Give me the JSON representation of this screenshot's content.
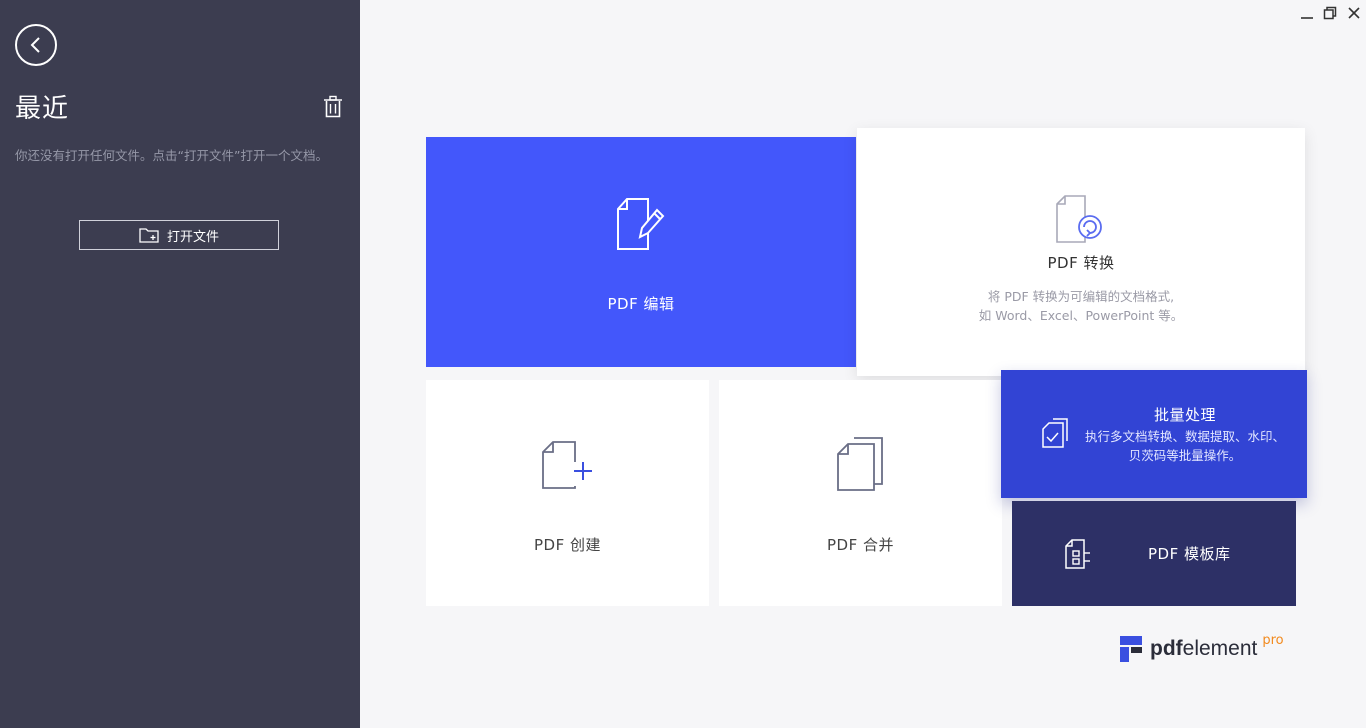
{
  "sidebar": {
    "title": "最近",
    "empty_message": "你还没有打开任何文件。点击“打开文件”打开一个文档。",
    "open_file_label": "打开文件"
  },
  "tiles": {
    "edit": {
      "label": "PDF 编辑",
      "icon": "edit-document-icon"
    },
    "convert": {
      "label": "PDF 转换",
      "desc_line1": "将 PDF 转换为可编辑的文档格式,",
      "desc_line2": "如 Word、Excel、PowerPoint 等。",
      "icon": "convert-document-icon"
    },
    "create": {
      "label": "PDF 创建",
      "icon": "create-document-icon"
    },
    "merge": {
      "label": "PDF 合并",
      "icon": "merge-documents-icon"
    },
    "batch": {
      "label": "批量处理",
      "desc_line1": "执行多文档转换、数据提取、水印、",
      "desc_line2": "贝茨码等批量操作。",
      "icon": "batch-process-icon"
    },
    "template": {
      "label": "PDF 模板库",
      "icon": "template-library-icon"
    }
  },
  "logo": {
    "brand_bold": "pdf",
    "brand_rest": "element",
    "badge": "pro"
  },
  "colors": {
    "sidebar_bg": "#3c3d50",
    "edit_tile": "#4357fb",
    "batch_tile": "#3244d4",
    "template_tile": "#2d3066",
    "pro_badge": "#f28a1e"
  }
}
